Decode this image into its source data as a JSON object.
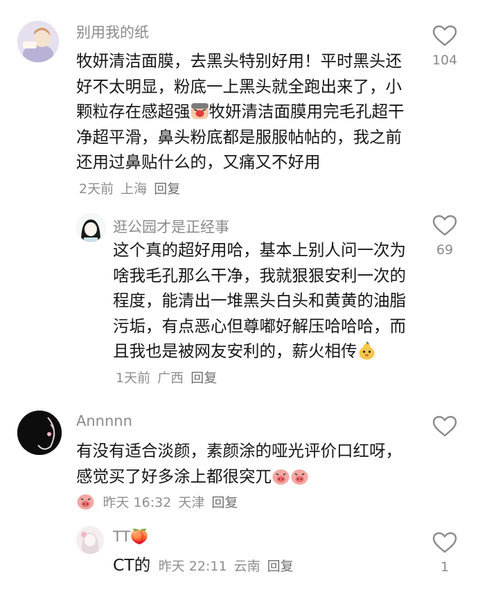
{
  "comments": [
    {
      "username": "别用我的纸",
      "text": "牧妍清洁面膜，去黑头特别好用！平时黑头还好不太明显，粉底一上黑头就全跑出来了，小颗粒存在感超强",
      "text2": "牧妍清洁面膜用完毛孔超干净超平滑，鼻头粉底都是服服帖帖的，我之前还用过鼻贴什么的，又痛又不好用",
      "time": "2天前",
      "location": "上海",
      "reply": "回复",
      "likes": "104",
      "emoji": "crying-face-emoji",
      "replies": [
        {
          "username": "逛公园才是正经事",
          "text": "这个真的超好用哈，基本上别人问一次为啥我毛孔那么干净，我就狠狠安利一次的程度，能清出一堆黑头白头和黄黄的油脂污垢，有点恶心但尊嘟好解压哈哈哈，而且我也是被网友安利的，薪火相传",
          "time": "1天前",
          "location": "广西",
          "reply": "回复",
          "likes": "69",
          "emoji": "gourd-emoji"
        }
      ]
    },
    {
      "username": "Annnnn",
      "text": "有没有适合淡颜，素颜涂的哑光评价口红呀，感觉买了好多涂上都很突兀",
      "time": "昨天 16:32",
      "location": "天津",
      "reply": "回复",
      "likes": "",
      "emoji": "pig-emoji",
      "replies": [
        {
          "username": "TT🍑",
          "text": "CT的",
          "time": "昨天 22:11",
          "location": "云南",
          "reply": "回复",
          "likes": "1"
        }
      ]
    }
  ],
  "colors": {
    "text": "#161616",
    "meta": "#8e8e8e",
    "name": "#8a8a8a"
  }
}
